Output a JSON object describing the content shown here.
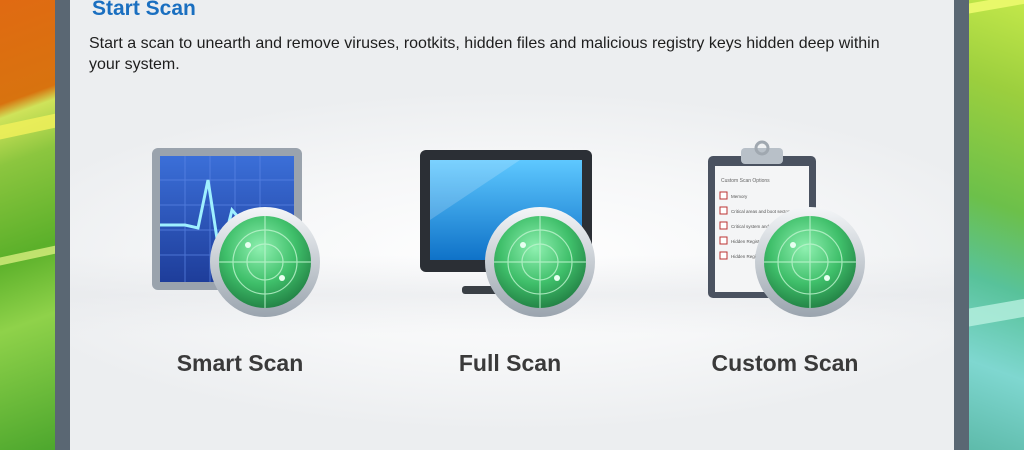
{
  "header": {
    "title": "Start Scan",
    "description": "Start a scan to unearth and remove viruses, rootkits, hidden files and malicious registry keys hidden deep within your system."
  },
  "scans": [
    {
      "label": "Smart Scan",
      "icon": "monitor-graph-radar-icon"
    },
    {
      "label": "Full Scan",
      "icon": "computer-monitor-radar-icon"
    },
    {
      "label": "Custom Scan",
      "icon": "clipboard-checklist-radar-icon"
    }
  ],
  "clipboard": {
    "heading": "Custom Scan Options",
    "items": [
      "Memory",
      "Critical areas and boot sector",
      "Critical system and ...",
      "Hidden Registry",
      "Hidden Registry"
    ]
  },
  "colors": {
    "title": "#1a6fc0",
    "radar": "#3fbf6a",
    "frame": "#5a6773"
  }
}
